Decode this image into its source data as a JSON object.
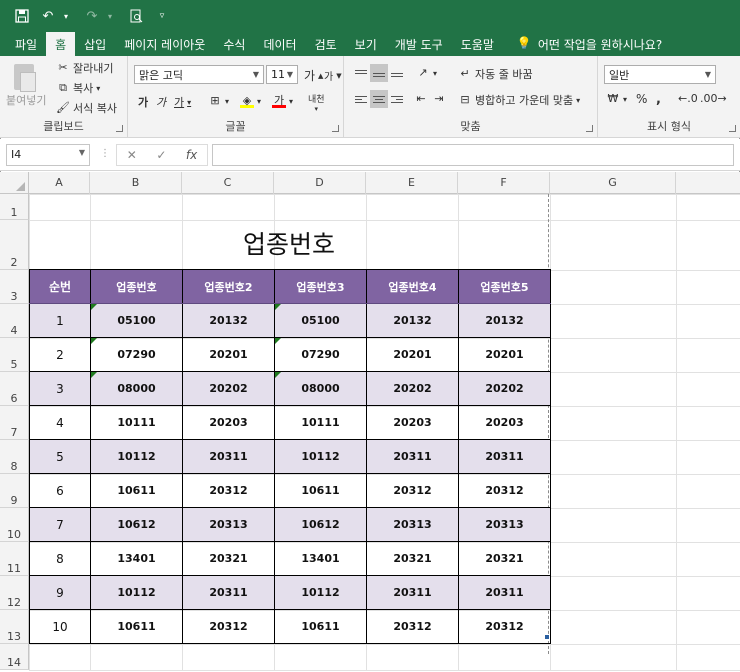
{
  "quick_access": {
    "save_icon": "save-icon",
    "undo_icon": "undo-icon",
    "redo_icon": "redo-icon",
    "preview_icon": "print-preview-icon",
    "customize_icon": "customize-qat-icon"
  },
  "tabs": [
    "파일",
    "홈",
    "삽입",
    "페이지 레이아웃",
    "수식",
    "데이터",
    "검토",
    "보기",
    "개발 도구",
    "도움말"
  ],
  "active_tab": "홈",
  "tell_me": "어떤 작업을 원하시나요?",
  "ribbon": {
    "clipboard": {
      "paste": "붙여넣기",
      "cut": "잘라내기",
      "copy": "복사",
      "format_painter": "서식 복사",
      "label": "클립보드"
    },
    "font": {
      "name": "맑은 고딕",
      "size": "11",
      "grow": "가",
      "shrink": "가",
      "bold": "가",
      "italic": "가",
      "underline": "가",
      "phonetic": "내천",
      "label": "글꼴"
    },
    "alignment": {
      "wrap": "자동 줄 바꿈",
      "merge": "병합하고 가운데 맞춤",
      "label": "맞춤"
    },
    "number": {
      "format": "일반",
      "percent": "%",
      "comma": ",",
      "label": "표시 형식"
    },
    "colors": {
      "highlight": "#ffff00",
      "font_color": "#ff0000",
      "accent": "#217346"
    }
  },
  "formula_bar": {
    "name_box": "I4",
    "cancel": "✕",
    "enter": "✓",
    "fx": "fx",
    "value": ""
  },
  "columns": [
    "A",
    "B",
    "C",
    "D",
    "E",
    "F",
    "G"
  ],
  "rows": [
    "1",
    "2",
    "3",
    "4",
    "5",
    "6",
    "7",
    "8",
    "9",
    "10",
    "11",
    "12",
    "13",
    "14"
  ],
  "sheet": {
    "title": "업종번호",
    "headers": [
      "순번",
      "업종번호",
      "업종번호2",
      "업종번호3",
      "업종번호4",
      "업종번호5"
    ],
    "header_color": "#8064a2",
    "alt_row_color": "#e4dfec",
    "data": [
      [
        "1",
        "05100",
        "20132",
        "05100",
        "20132",
        "20132"
      ],
      [
        "2",
        "07290",
        "20201",
        "07290",
        "20201",
        "20201"
      ],
      [
        "3",
        "08000",
        "20202",
        "08000",
        "20202",
        "20202"
      ],
      [
        "4",
        "10111",
        "20203",
        "10111",
        "20203",
        "20203"
      ],
      [
        "5",
        "10112",
        "20311",
        "10112",
        "20311",
        "20311"
      ],
      [
        "6",
        "10611",
        "20312",
        "10611",
        "20312",
        "20312"
      ],
      [
        "7",
        "10612",
        "20313",
        "10612",
        "20313",
        "20313"
      ],
      [
        "8",
        "13401",
        "20321",
        "13401",
        "20321",
        "20321"
      ],
      [
        "9",
        "10112",
        "20311",
        "10112",
        "20311",
        "20311"
      ],
      [
        "10",
        "10611",
        "20312",
        "10611",
        "20312",
        "20312"
      ]
    ]
  }
}
